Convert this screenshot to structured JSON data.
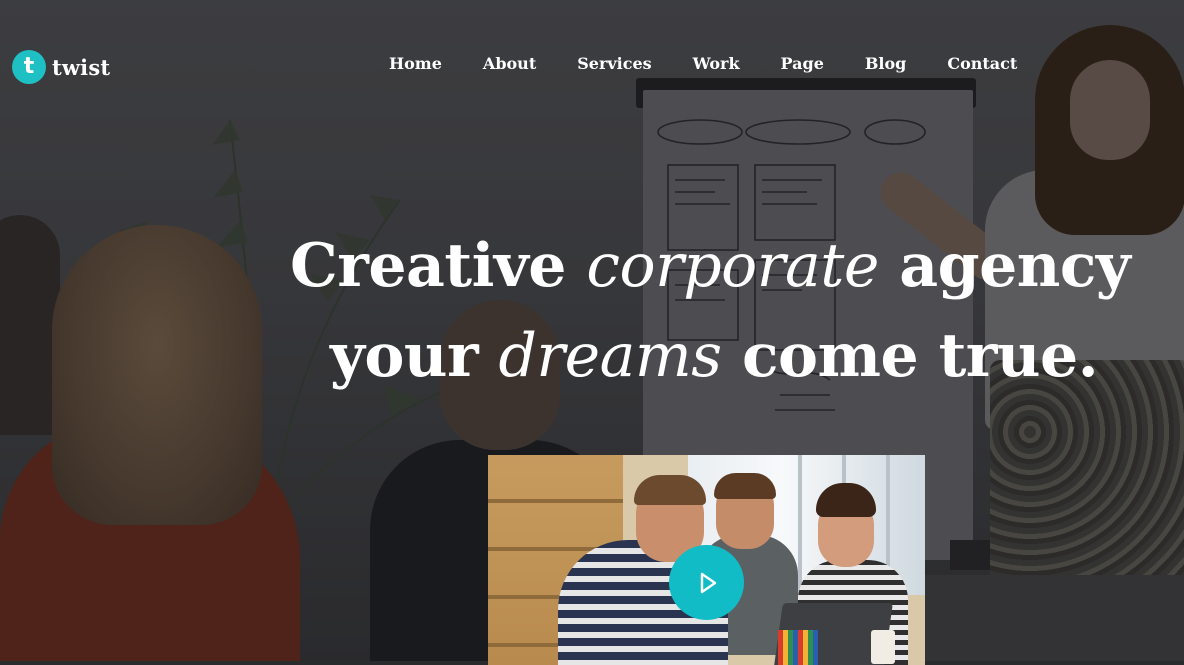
{
  "brand": {
    "name": "twist",
    "icon_letter": "t",
    "accent_color": "#1fc0c4"
  },
  "nav": {
    "items": [
      {
        "label": "Home"
      },
      {
        "label": "About"
      },
      {
        "label": "Services"
      },
      {
        "label": "Work"
      },
      {
        "label": "Page"
      },
      {
        "label": "Blog"
      },
      {
        "label": "Contact"
      }
    ]
  },
  "hero": {
    "line1": {
      "part1": "Creative ",
      "emphasis": "corporate",
      "part2": " agency"
    },
    "line2": {
      "part1": "your ",
      "emphasis": "dreams",
      "part2": " come true."
    }
  },
  "video": {
    "play_icon": "play-icon",
    "play_color": "#12bcc6"
  }
}
